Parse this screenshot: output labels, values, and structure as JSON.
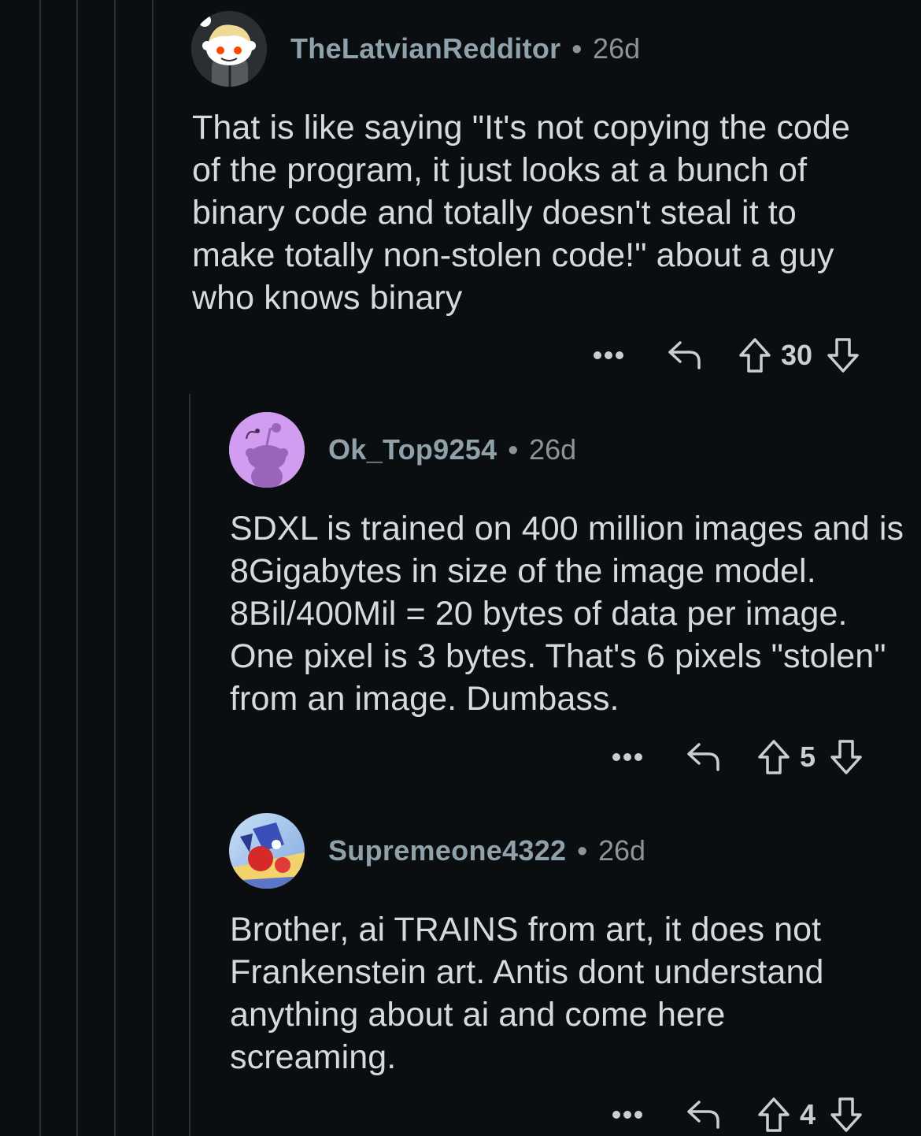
{
  "comments": [
    {
      "username": "TheLatvianRedditor",
      "separator": "•",
      "age": "26d",
      "body": "That is like saying \"It's not copying the code of the program, it just looks at a bunch of binary code and totally doesn't steal it to make totally non-stolen code!\" about a guy who knows binary",
      "score": "30",
      "avatar_icon": "snoo-avatar-icon"
    },
    {
      "username": "Ok_Top9254",
      "separator": "•",
      "age": "26d",
      "body": "SDXL is trained on 400 million images and is 8Gigabytes in size of the image model. 8Bil/400Mil = 20 bytes of data per image. One pixel is 3 bytes. That's 6 pixels \"stolen\" from an image. Dumbass.",
      "score": "5",
      "avatar_icon": "purple-snoo-avatar-icon"
    },
    {
      "username": "Supremeone4322",
      "separator": "•",
      "age": "26d",
      "body": "Brother, ai TRAINS from art, it does not Frankenstein art. Antis dont understand anything about ai and come here screaming.",
      "score": "4",
      "avatar_icon": "custom-image-avatar-icon"
    }
  ],
  "icons": {
    "more": "more-options-icon",
    "reply": "reply-icon",
    "upvote": "upvote-arrow-icon",
    "downvote": "downvote-arrow-icon"
  },
  "colors": {
    "background": "#0b0e11",
    "text": "#d7dadc",
    "username": "#8fa1aa",
    "thread_line": "#2a2f33",
    "purple_avatar": "#d29cf0"
  }
}
